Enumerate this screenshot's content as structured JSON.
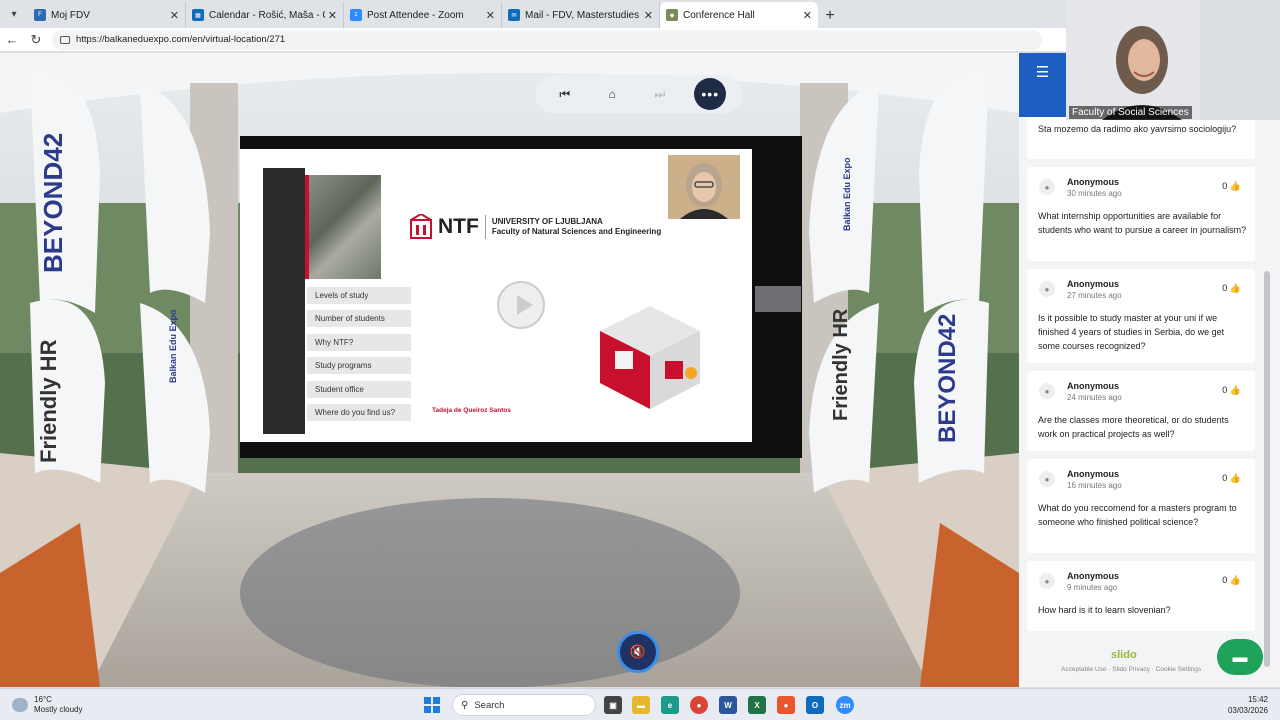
{
  "browser": {
    "tabs": [
      {
        "title": "Moj FDV",
        "icon": "fdv-icon",
        "color": "#2e6bb5",
        "active": false
      },
      {
        "title": "Calendar - Rošić, Maša - Outlook",
        "icon": "outlook-calendar-icon",
        "color": "#0f6cbd",
        "active": false
      },
      {
        "title": "Post Attendee - Zoom",
        "icon": "zoom-icon",
        "color": "#2d8cff",
        "active": false
      },
      {
        "title": "Mail - FDV, Masterstudies - Outlook",
        "icon": "outlook-mail-icon",
        "color": "#0f6cbd",
        "active": false
      },
      {
        "title": "Conference Hall",
        "icon": "conference-hall-icon",
        "color": "#7a8a5a",
        "active": true
      }
    ],
    "url": "https://balkaneduexpo.com/en/virtual-location/271"
  },
  "scene": {
    "banners": [
      "BEYOND42",
      "Friendly HR",
      "Balkan Edu Expo"
    ],
    "controls": [
      "skip-back",
      "home",
      "skip-forward",
      "more"
    ]
  },
  "slide": {
    "menu": [
      "Levels of study",
      "Number of students",
      "Why NTF?",
      "Study programs",
      "Student office",
      "Where do you find us?"
    ],
    "logo_abbrev": "NTF",
    "logo_line1": "UNIVERSITY OF LJUBLJANA",
    "logo_line2": "Faculty of Natural Sciences and Engineering",
    "presenter": "Tadeja de Queiroz Santos"
  },
  "video_tile": {
    "name": "Faculty of Social Sciences"
  },
  "questions": [
    {
      "author": "",
      "time": "",
      "likes": "",
      "text": "Sta mozemo da radimo ako yavrsimo sociologiju?"
    },
    {
      "author": "Anonymous",
      "time": "30 minutes ago",
      "likes": "0",
      "text": "What internship opportunities are available for students who want to pursue a career in journalism?"
    },
    {
      "author": "Anonymous",
      "time": "27 minutes ago",
      "likes": "0",
      "text": "Is it possible to study master at your uni if we finished 4 years of studies in Serbia, do we get some courses recognized?"
    },
    {
      "author": "Anonymous",
      "time": "24 minutes ago",
      "likes": "0",
      "text": "Are the classes more theoretical, or do students work on practical projects as well?"
    },
    {
      "author": "Anonymous",
      "time": "16 minutes ago",
      "likes": "0",
      "text": "What do you reccomend for a masters program to someone who finished political science?"
    },
    {
      "author": "Anonymous",
      "time": "9 minutes ago",
      "likes": "0",
      "text": "How hard is it to learn slovenian?"
    }
  ],
  "slido": {
    "brand": "slido",
    "footer": "Acceptable Use · Slido Privacy · Cookie Settings"
  },
  "taskbar": {
    "temperature": "16°C",
    "weather": "Mostly cloudy",
    "search_placeholder": "Search",
    "time": "15:42",
    "date": "03/03/2026"
  }
}
